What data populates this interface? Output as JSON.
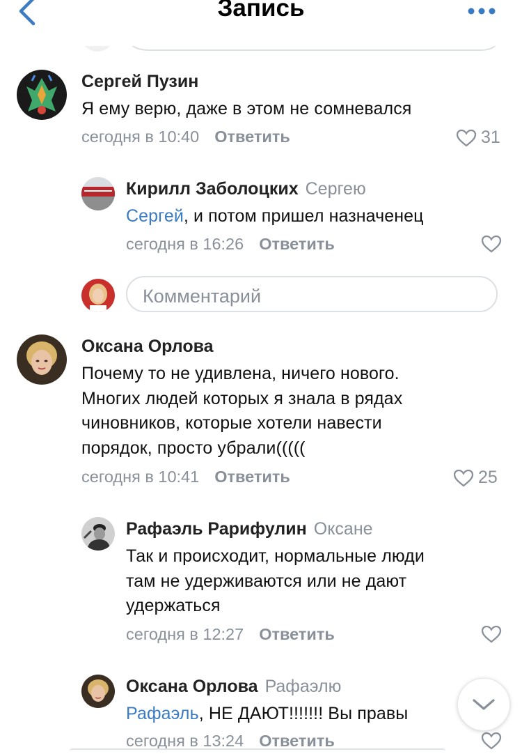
{
  "header": {
    "title": "Запись"
  },
  "comments": [
    {
      "author": "Сергей Пузин",
      "text": "Я ему верю, даже в этом не сомневался",
      "time": "сегодня в 10:40",
      "reply_label": "Ответить",
      "likes": "31"
    },
    {
      "author": "Кирилл Заболоцких",
      "reply_to": "Сергею",
      "mention": "Сергей",
      "text": ", и потом пришел назначенец",
      "time": "сегодня в 16:26",
      "reply_label": "Ответить"
    },
    {
      "author": "Оксана Орлова",
      "text_lines": [
        "Почему то не удивлена, ничего нового.",
        "Многих людей которых я знала в рядах",
        "чиновников, которые хотели навести",
        "порядок, просто убрали((((("
      ],
      "time": "сегодня в 10:41",
      "reply_label": "Ответить",
      "likes": "25"
    },
    {
      "author": "Рафаэль Рарифулин",
      "reply_to": "Оксане",
      "text_lines": [
        "Так и происходит, нормальные люди",
        "там не удерживаются или не дают",
        "удержаться"
      ],
      "time": "сегодня в 12:27",
      "reply_label": "Ответить"
    },
    {
      "author": "Оксана Орлова",
      "reply_to": "Рафаэлю",
      "mention": "Рафаэль",
      "text": ", НЕ ДАЮТ!!!!!!! Вы правы",
      "time": "сегодня в 13:24",
      "reply_label": "Ответить"
    }
  ],
  "comment_input": {
    "placeholder": "Комментарий"
  },
  "colors": {
    "accent": "#3b7bc4",
    "secondary_text": "#8a9099",
    "divider": "#dcdfe3"
  }
}
